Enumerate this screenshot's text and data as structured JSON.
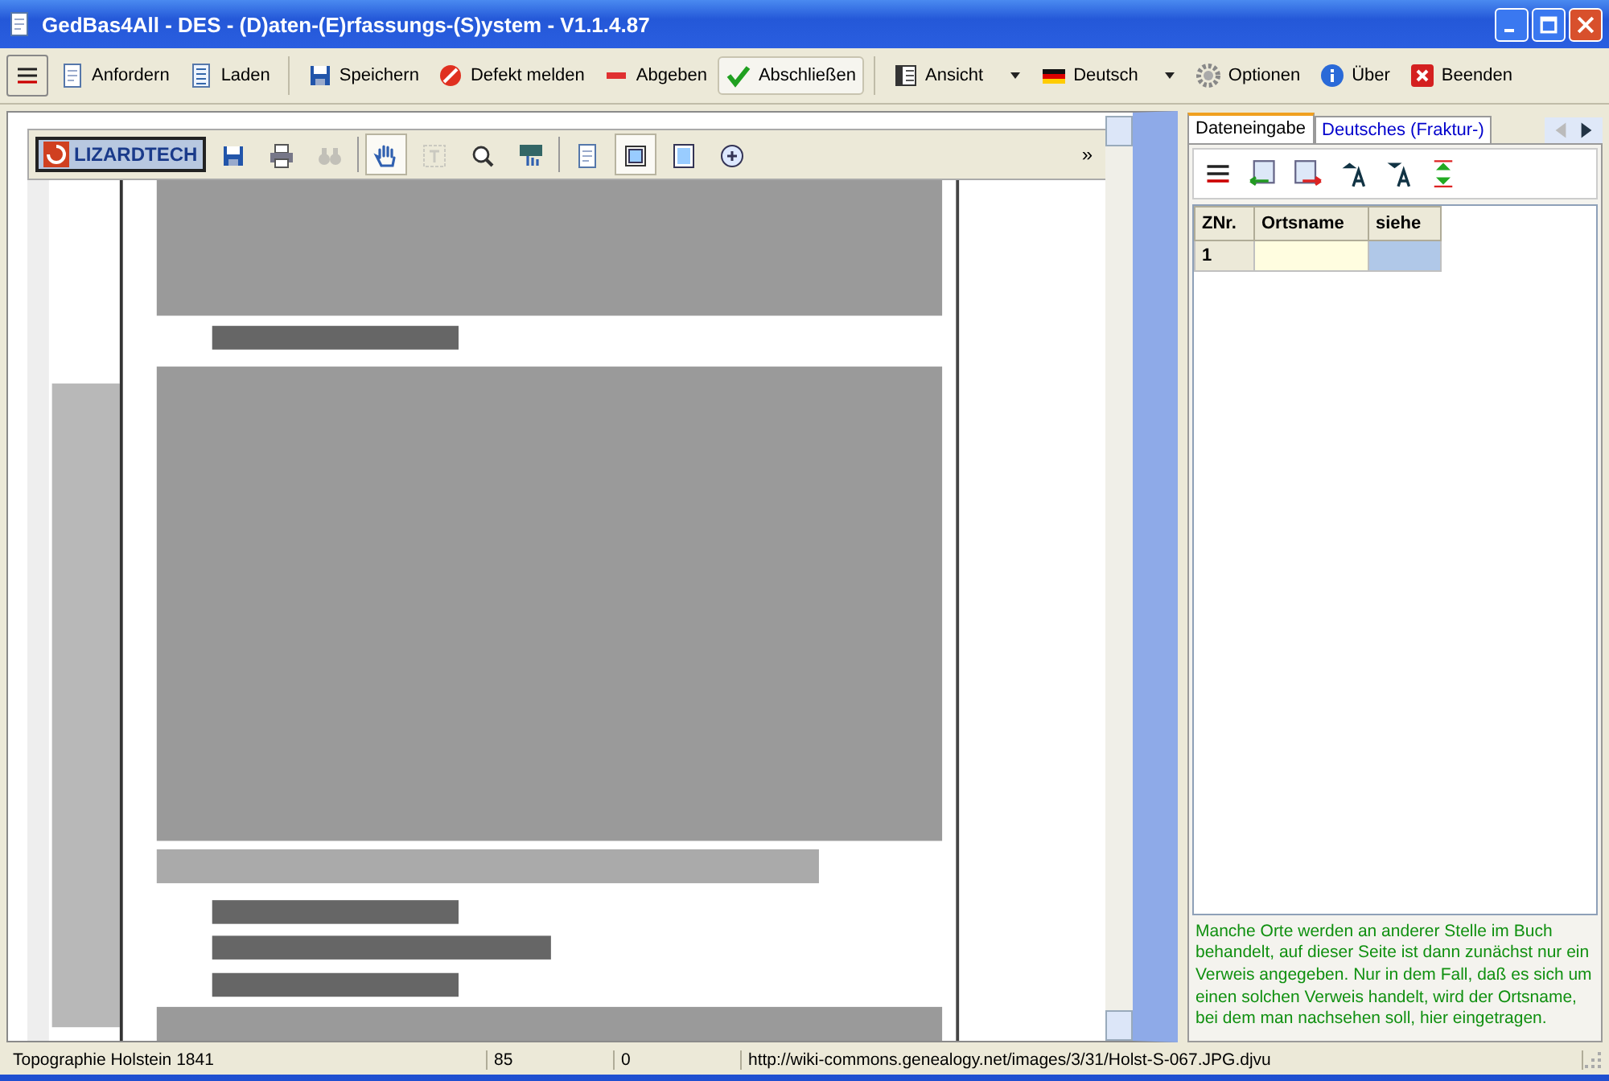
{
  "window": {
    "title": "GedBas4All - DES - (D)aten-(E)rfassungs-(S)ystem - V1.1.4.87"
  },
  "toolbar": [
    {
      "kind": "icon"
    },
    {
      "kind": "button",
      "label": "Anfordern",
      "pressed": false
    },
    {
      "kind": "button",
      "label": "Laden",
      "pressed": false
    },
    {
      "kind": "sep"
    },
    {
      "kind": "button",
      "label": "Speichern",
      "pressed": false
    },
    {
      "kind": "button",
      "label": "Defekt melden",
      "pressed": false
    },
    {
      "kind": "button",
      "label": "Abgeben",
      "pressed": false
    },
    {
      "kind": "button",
      "label": "Abschließen",
      "pressed": true
    },
    {
      "kind": "sep"
    },
    {
      "kind": "menu",
      "label": "Ansicht"
    },
    {
      "kind": "menu",
      "label": "Deutsch"
    },
    {
      "kind": "button",
      "label": "Optionen",
      "pressed": false
    },
    {
      "kind": "button",
      "label": "Über",
      "pressed": false
    },
    {
      "kind": "button",
      "label": "Beenden",
      "pressed": false
    }
  ],
  "viewer": {
    "logo": "LIZARDTECH",
    "tools": [
      {
        "selected": false,
        "disabled": false
      },
      {
        "selected": false,
        "disabled": false
      },
      {
        "selected": false,
        "disabled": true
      },
      {
        "selected": true,
        "disabled": false
      },
      {
        "selected": false,
        "disabled": true
      },
      {
        "selected": false,
        "disabled": false
      },
      {
        "selected": false,
        "disabled": false
      },
      {
        "selected": false,
        "disabled": false
      },
      {
        "selected": true,
        "disabled": false
      },
      {
        "selected": false,
        "disabled": false
      },
      {
        "selected": false,
        "disabled": false
      }
    ],
    "more": "»"
  },
  "side": {
    "tabs": [
      {
        "label": "Dateneingabe",
        "selected": true
      },
      {
        "label": "Deutsches (Fraktur-)",
        "selected": false
      }
    ],
    "table": {
      "columns": [
        "ZNr.",
        "Ortsname",
        "siehe"
      ],
      "rows": [
        {
          "number": "1"
        }
      ]
    },
    "note": "Manche Orte werden an anderer Stelle im Buch behandelt, auf dieser Seite ist dann zunächst nur ein Verweis angegeben. Nur in dem Fall, daß es sich um einen solchen Verweis handelt, wird der Ortsname, bei dem man nachsehen soll, hier eingetragen."
  },
  "status_bar": [
    "Topographie Holstein 1841",
    "85",
    "0",
    "http://wiki-commons.genealogy.net/images/3/31/Holst-S-067.JPG.djvu"
  ]
}
